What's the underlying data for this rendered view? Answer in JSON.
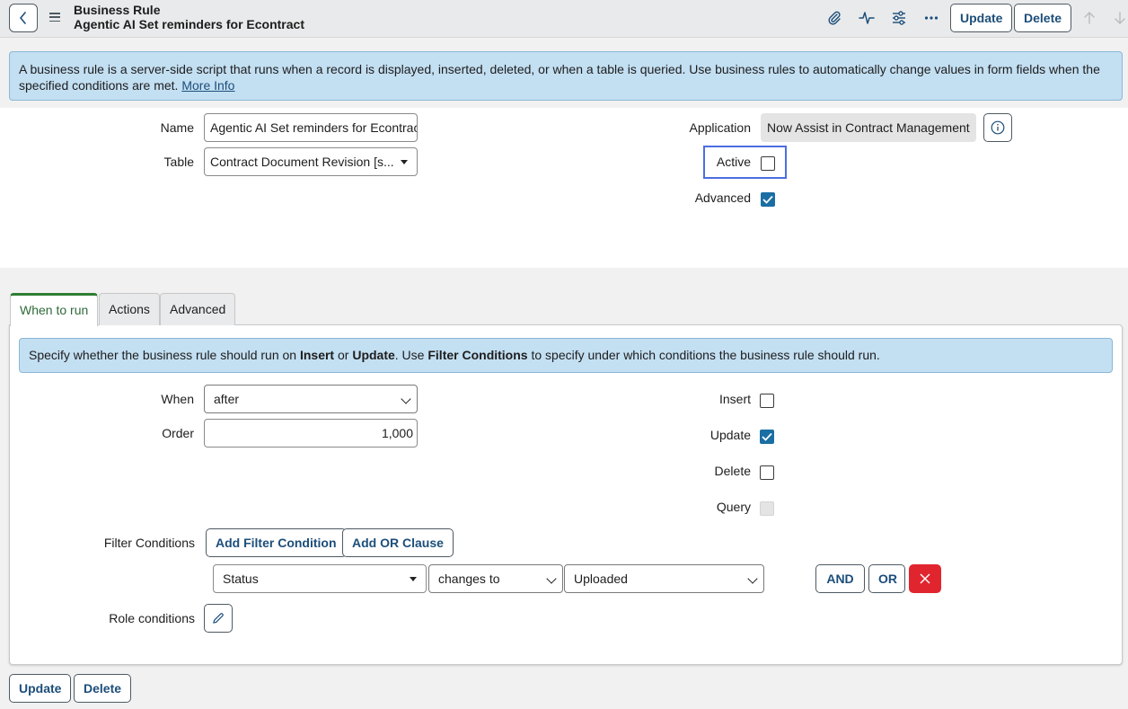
{
  "header": {
    "record_type": "Business Rule",
    "record_name": "Agentic AI Set reminders for Econtract",
    "update_label": "Update",
    "delete_label": "Delete"
  },
  "banner": {
    "text": "A business rule is a server-side script that runs when a record is displayed, inserted, deleted, or when a table is queried. Use business rules to automatically change values in form fields when the specified conditions are met. ",
    "link": "More Info"
  },
  "form": {
    "name_label": "Name",
    "name_value": "Agentic AI Set reminders for Econtract",
    "table_label": "Table",
    "table_value": "Contract Document Revision [s...",
    "application_label": "Application",
    "application_value": "Now Assist in Contract Management",
    "active_label": "Active",
    "active_checked": false,
    "advanced_label": "Advanced",
    "advanced_checked": true
  },
  "tabs": [
    {
      "label": "When to run",
      "active": true
    },
    {
      "label": "Actions",
      "active": false
    },
    {
      "label": "Advanced",
      "active": false
    }
  ],
  "when_to_run": {
    "banner_pre": "Specify whether the business rule should run on ",
    "banner_insert": "Insert",
    "banner_or": " or ",
    "banner_update": "Update",
    "banner_use": ". Use ",
    "banner_fc": "Filter Conditions",
    "banner_post": " to specify under which conditions the business rule should run.",
    "when_label": "When",
    "when_value": "after",
    "order_label": "Order",
    "order_value": "1,000",
    "insert_label": "Insert",
    "insert_checked": false,
    "update_label": "Update",
    "update_checked": true,
    "delete_label": "Delete",
    "delete_checked": false,
    "query_label": "Query",
    "query_disabled": true,
    "filter_label": "Filter Conditions",
    "add_filter_label": "Add Filter Condition",
    "add_or_label": "Add OR Clause",
    "condition": {
      "field": "Status",
      "operator": "changes to",
      "value": "Uploaded"
    },
    "and_label": "AND",
    "or_label": "OR",
    "role_label": "Role conditions"
  },
  "footer": {
    "update_label": "Update",
    "delete_label": "Delete"
  },
  "colors": {
    "accent": "#1c4e7a",
    "banner": "#c3dff2",
    "tab_active": "#2e7d32",
    "danger": "#e1252f",
    "checkbox": "#1a6ea4",
    "focus": "#4c6ee0"
  }
}
